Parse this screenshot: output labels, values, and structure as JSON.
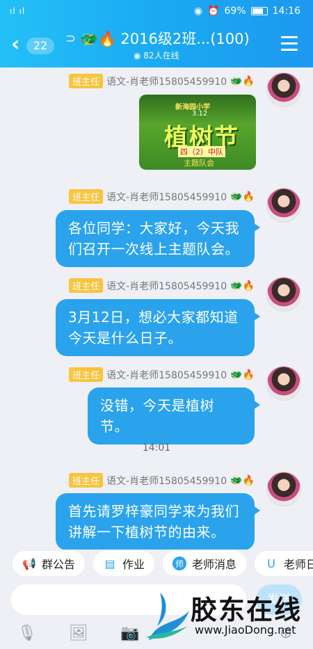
{
  "status": {
    "signal": "ıl ıl",
    "battery": "69%",
    "time": "14:16"
  },
  "header": {
    "back_count": "22",
    "title": "2016级2班...(100)",
    "online": "82人在线"
  },
  "messages": [
    {
      "role": "班主任",
      "sender": "语文-肖老师15805459910",
      "type": "image",
      "image": {
        "school": "新海园小学",
        "date": "3.12",
        "headline": "植树节",
        "class": "四（2）中队",
        "theme": "主题队会"
      }
    },
    {
      "role": "班主任",
      "sender": "语文-肖老师15805459910",
      "type": "text",
      "lines": [
        "各位同学：大家好，今天我",
        "们召开一次线上主题队会。"
      ]
    },
    {
      "role": "班主任",
      "sender": "语文-肖老师15805459910",
      "type": "text",
      "lines": [
        "3月12日，想必大家都知道",
        "今天是什么日子。"
      ]
    },
    {
      "role": "班主任",
      "sender": "语文-肖老师15805459910",
      "type": "text",
      "lines": [
        "没错，今天是植树节。"
      ]
    },
    {
      "role": "班主任",
      "sender": "语文-肖老师15805459910",
      "type": "text",
      "lines": [
        "首先请罗梓豪同学来为我们",
        "讲解一下植树节的由来。"
      ]
    }
  ],
  "time_divider": "14:01",
  "chips": [
    "群公告",
    "作业",
    "老师消息",
    "老师日"
  ],
  "chip_icon_teacher": "师",
  "input": {
    "send_label": "发送"
  },
  "watermark": {
    "name": "胶东在线",
    "url": "www.JiaoDong.net"
  },
  "accent": "#2aa3ec",
  "icons": [
    "back-icon",
    "ear-icon",
    "menu-icon",
    "megaphone-icon",
    "homework-icon",
    "teacher-icon",
    "microphone-icon",
    "image-icon",
    "camera-icon",
    "more-icon"
  ]
}
